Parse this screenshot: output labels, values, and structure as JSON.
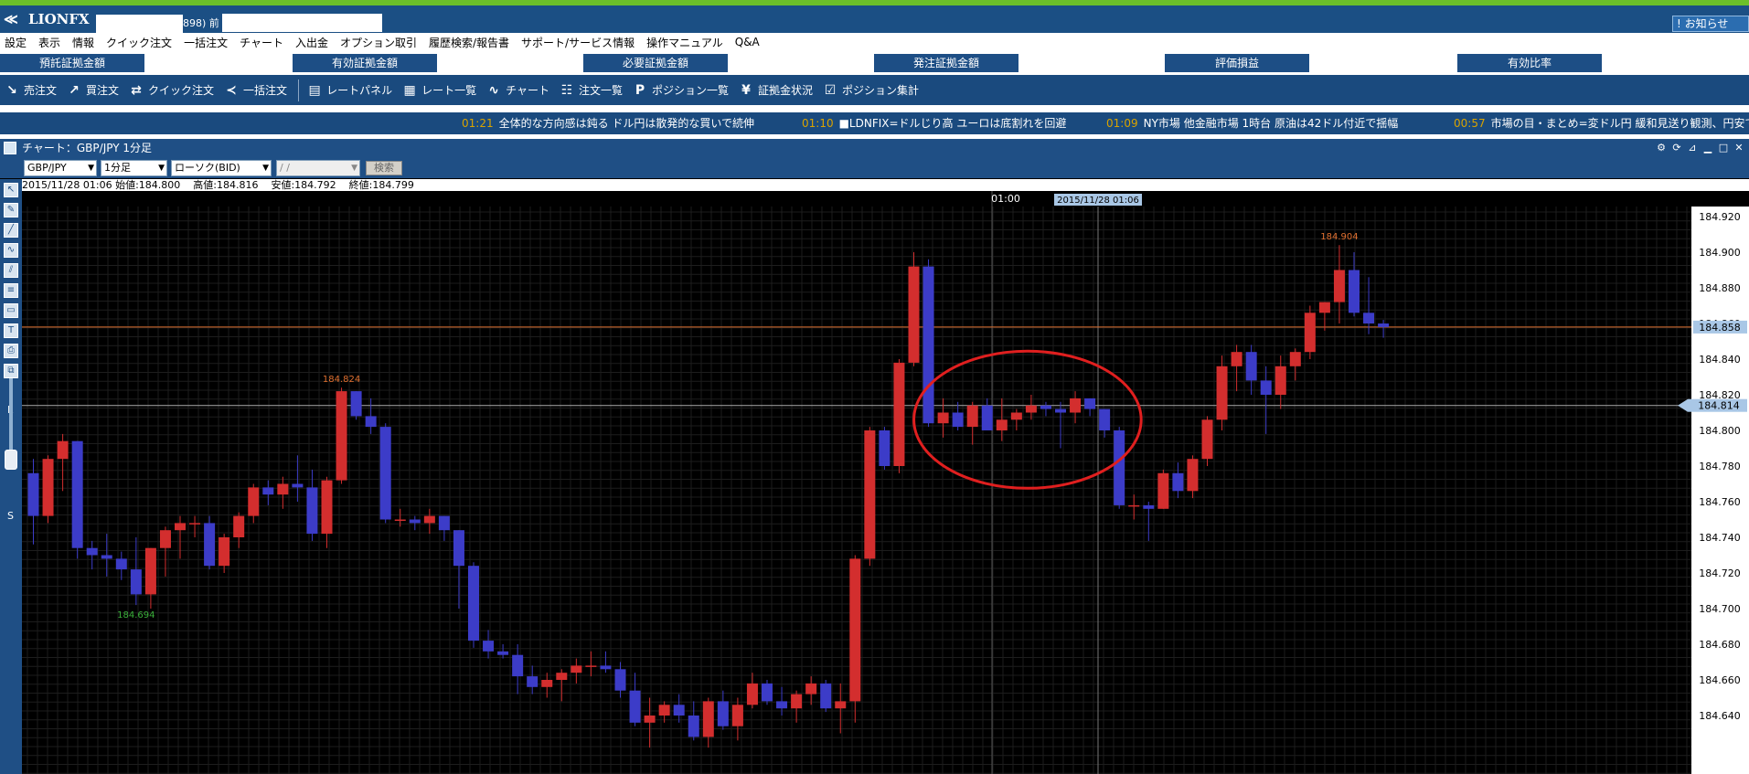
{
  "app": {
    "logo_text": "LIONFX",
    "account_fragment": "898)  前",
    "notice_button": "! お知らせ"
  },
  "menu": [
    "設定",
    "表示",
    "情報",
    "クイック注文",
    "一括注文",
    "チャート",
    "入出金",
    "オプション取引",
    "履歴検索/報告書",
    "サポート/サービス情報",
    "操作マニュアル",
    "Q&A"
  ],
  "status_labels": [
    "預託証拠金額",
    "有効証拠金額",
    "必要証拠金額",
    "発注証拠金額",
    "評価損益",
    "有効比率"
  ],
  "toolbar": [
    {
      "icon": "sell-arrow-icon",
      "label": "売注文"
    },
    {
      "icon": "buy-arrow-icon",
      "label": "買注文"
    },
    {
      "icon": "quick-order-icon",
      "label": "クイック注文"
    },
    {
      "icon": "bulk-order-icon",
      "label": "一括注文"
    },
    {
      "icon": "rate-panel-icon",
      "label": "レートパネル"
    },
    {
      "icon": "rate-list-icon",
      "label": "レート一覧"
    },
    {
      "icon": "chart-icon",
      "label": "チャート"
    },
    {
      "icon": "order-list-icon",
      "label": "注文一覧"
    },
    {
      "icon": "position-list-icon",
      "label": "ポジション一覧"
    },
    {
      "icon": "yen-icon",
      "label": "証拠金状況"
    },
    {
      "icon": "position-summary-icon",
      "label": "ポジション集計"
    }
  ],
  "ticker": [
    {
      "time": "01:21",
      "text": "全体的な方向感は鈍る ドル円は散発的な買いで続伸"
    },
    {
      "time": "01:10",
      "text": "■LDNFIX=ドルじり高 ユーロは底割れを回避"
    },
    {
      "time": "01:09",
      "text": "NY市場 他金融市場 1時台 原油は42ドル付近で揺幅"
    },
    {
      "time": "00:57",
      "text": "市場の目・まとめ=変ドル円 緩和見送り観測、円安で"
    }
  ],
  "chart_window": {
    "title": "チャート：GBP/JPY 1分足",
    "pair": "GBP/JPY",
    "timeframe": "1分足",
    "type": "ローソク(BID)",
    "date_field": "/ /",
    "search_button": "検索",
    "ohlc_line": "2015/11/28 01:06 始値:184.800    高値:184.816    安値:184.792    終値:184.799",
    "slider_top": "L",
    "slider_bottom": "S"
  },
  "chart_data": {
    "type": "candlestick",
    "symbol": "GBP/JPY",
    "interval": "1分足",
    "ylim": [
      184.62,
      184.93
    ],
    "y_ticks": [
      184.92,
      184.9,
      184.88,
      184.86,
      184.84,
      184.82,
      184.8,
      184.78,
      184.76,
      184.74,
      184.72,
      184.7,
      184.68,
      184.66,
      184.64
    ],
    "x_label": "01:00",
    "crosshair_time": "2015/11/28 01:06",
    "price_tags": {
      "horizontal_line": "184.858",
      "crosshair": "184.814"
    },
    "annotations": [
      {
        "text": "184.824",
        "type": "high"
      },
      {
        "text": "184.694",
        "type": "low"
      },
      {
        "text": "184.904",
        "type": "high"
      }
    ],
    "colors": {
      "up": "#d32e2e",
      "down": "#3c3cc8",
      "background": "#000000",
      "hline": "#e07030",
      "circle": "#e01f1f"
    },
    "candles": [
      [
        184.776,
        184.784,
        184.736,
        184.752
      ],
      [
        184.752,
        184.786,
        184.748,
        184.784
      ],
      [
        184.784,
        184.798,
        184.766,
        184.794
      ],
      [
        184.794,
        184.794,
        184.728,
        184.734
      ],
      [
        184.734,
        184.738,
        184.722,
        184.73
      ],
      [
        184.73,
        184.742,
        184.718,
        184.728
      ],
      [
        184.728,
        184.732,
        184.716,
        184.722
      ],
      [
        184.722,
        184.74,
        184.702,
        184.708
      ],
      [
        184.708,
        184.734,
        184.7,
        184.734
      ],
      [
        184.734,
        184.746,
        184.718,
        184.744
      ],
      [
        184.744,
        184.752,
        184.728,
        184.748
      ],
      [
        184.748,
        184.752,
        184.74,
        184.748
      ],
      [
        184.748,
        184.752,
        184.722,
        184.724
      ],
      [
        184.724,
        184.742,
        184.72,
        184.74
      ],
      [
        184.74,
        184.754,
        184.734,
        184.752
      ],
      [
        184.752,
        184.77,
        184.748,
        184.768
      ],
      [
        184.768,
        184.772,
        184.758,
        184.764
      ],
      [
        184.764,
        184.774,
        184.756,
        184.77
      ],
      [
        184.77,
        184.786,
        184.76,
        184.768
      ],
      [
        184.768,
        184.778,
        184.738,
        184.742
      ],
      [
        184.742,
        184.774,
        184.734,
        184.772
      ],
      [
        184.772,
        184.824,
        184.77,
        184.822
      ],
      [
        184.822,
        184.822,
        184.806,
        184.808
      ],
      [
        184.808,
        184.818,
        184.798,
        184.802
      ],
      [
        184.802,
        184.804,
        184.748,
        184.75
      ],
      [
        184.75,
        184.756,
        184.746,
        184.75
      ],
      [
        184.75,
        184.752,
        184.744,
        184.748
      ],
      [
        184.748,
        184.756,
        184.742,
        184.752
      ],
      [
        184.752,
        184.752,
        184.738,
        184.744
      ],
      [
        184.744,
        184.744,
        184.7,
        184.724
      ],
      [
        184.724,
        184.726,
        184.678,
        184.682
      ],
      [
        184.682,
        184.688,
        184.672,
        184.676
      ],
      [
        184.676,
        184.68,
        184.672,
        184.674
      ],
      [
        184.674,
        184.68,
        184.652,
        184.662
      ],
      [
        184.662,
        184.668,
        184.652,
        184.656
      ],
      [
        184.656,
        184.664,
        184.65,
        184.66
      ],
      [
        184.66,
        184.666,
        184.648,
        184.664
      ],
      [
        184.664,
        184.672,
        184.658,
        184.668
      ],
      [
        184.668,
        184.676,
        184.662,
        184.668
      ],
      [
        184.668,
        184.676,
        184.664,
        184.666
      ],
      [
        184.666,
        184.67,
        184.65,
        184.654
      ],
      [
        184.654,
        184.664,
        184.634,
        184.636
      ],
      [
        184.636,
        184.65,
        184.622,
        184.64
      ],
      [
        184.64,
        184.648,
        184.636,
        184.646
      ],
      [
        184.646,
        184.652,
        184.636,
        184.64
      ],
      [
        184.64,
        184.648,
        184.626,
        184.628
      ],
      [
        184.628,
        184.65,
        184.622,
        184.648
      ],
      [
        184.648,
        184.654,
        184.632,
        184.634
      ],
      [
        184.634,
        184.65,
        184.626,
        184.646
      ],
      [
        184.646,
        184.664,
        184.644,
        184.658
      ],
      [
        184.658,
        184.66,
        184.646,
        184.648
      ],
      [
        184.648,
        184.656,
        184.64,
        184.644
      ],
      [
        184.644,
        184.654,
        184.636,
        184.652
      ],
      [
        184.652,
        184.662,
        184.646,
        184.658
      ],
      [
        184.658,
        184.66,
        184.642,
        184.644
      ],
      [
        184.644,
        184.658,
        184.63,
        184.648
      ],
      [
        184.648,
        184.73,
        184.636,
        184.728
      ],
      [
        184.728,
        184.802,
        184.724,
        184.8
      ],
      [
        184.8,
        184.802,
        184.778,
        184.78
      ],
      [
        184.78,
        184.84,
        184.776,
        184.838
      ],
      [
        184.838,
        184.9,
        184.836,
        184.892
      ],
      [
        184.892,
        184.896,
        184.802,
        184.804
      ],
      [
        184.804,
        184.818,
        184.796,
        184.81
      ],
      [
        184.81,
        184.816,
        184.8,
        184.802
      ],
      [
        184.802,
        184.816,
        184.792,
        184.814
      ],
      [
        184.814,
        184.818,
        184.8,
        184.8
      ],
      [
        184.8,
        184.818,
        184.794,
        184.806
      ],
      [
        184.806,
        184.812,
        184.8,
        184.81
      ],
      [
        184.81,
        184.82,
        184.806,
        184.814
      ],
      [
        184.814,
        184.816,
        184.808,
        184.812
      ],
      [
        184.812,
        184.816,
        184.79,
        184.81
      ],
      [
        184.81,
        184.822,
        184.804,
        184.818
      ],
      [
        184.818,
        184.818,
        184.808,
        184.812
      ],
      [
        184.812,
        184.812,
        184.796,
        184.8
      ],
      [
        184.8,
        184.802,
        184.756,
        184.758
      ],
      [
        184.758,
        184.764,
        184.75,
        184.758
      ],
      [
        184.758,
        184.76,
        184.738,
        184.756
      ],
      [
        184.756,
        184.778,
        184.756,
        184.776
      ],
      [
        184.776,
        184.782,
        184.762,
        184.766
      ],
      [
        184.766,
        184.786,
        184.762,
        184.784
      ],
      [
        184.784,
        184.808,
        184.78,
        184.806
      ],
      [
        184.806,
        184.842,
        184.8,
        184.836
      ],
      [
        184.836,
        184.848,
        184.822,
        184.844
      ],
      [
        184.844,
        184.848,
        184.82,
        184.828
      ],
      [
        184.828,
        184.836,
        184.798,
        184.82
      ],
      [
        184.82,
        184.842,
        184.812,
        184.836
      ],
      [
        184.836,
        184.846,
        184.828,
        184.844
      ],
      [
        184.844,
        184.87,
        184.84,
        184.866
      ],
      [
        184.866,
        184.872,
        184.856,
        184.872
      ],
      [
        184.872,
        184.904,
        184.86,
        184.89
      ],
      [
        184.89,
        184.9,
        184.864,
        184.866
      ],
      [
        184.866,
        184.886,
        184.854,
        184.86
      ],
      [
        184.86,
        184.862,
        184.852,
        184.858
      ]
    ]
  }
}
